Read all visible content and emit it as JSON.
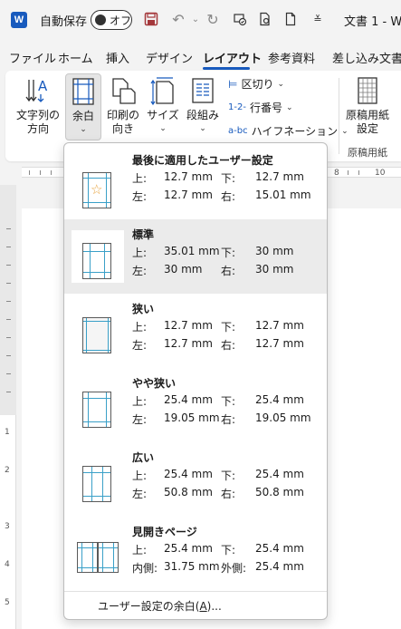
{
  "titlebar": {
    "app_icon": "W",
    "autosave_label": "自動保存",
    "autosave_state": "オフ",
    "doc_title": "文書 1 - W"
  },
  "tabs": [
    "ファイル",
    "ホーム",
    "挿入",
    "デザイン",
    "レイアウト",
    "参考資料",
    "差し込み文書"
  ],
  "active_tab": "レイアウト",
  "ribbon": {
    "text_direction": [
      "文字列の",
      "方向"
    ],
    "margins": [
      "余白"
    ],
    "orientation": [
      "印刷の",
      "向き"
    ],
    "size": [
      "サイズ"
    ],
    "columns": [
      "段組み"
    ],
    "breaks": "区切り",
    "line_numbers": "行番号",
    "hyphenation": "ハイフネーション",
    "manuscript": [
      "原稿用紙",
      "設定"
    ],
    "group_label": "原稿用紙"
  },
  "ruler": {
    "h_numbers": [
      "8",
      "10"
    ],
    "v_numbers": [
      "1",
      "2",
      "3",
      "4",
      "5"
    ]
  },
  "margins_menu": {
    "options": [
      {
        "name": "最後に適用したユーザー設定",
        "top_label": "上:",
        "top": "12.7 mm",
        "bottom_label": "下:",
        "bottom": "12.7 mm",
        "left_label": "左:",
        "left": "12.7 mm",
        "right_label": "右:",
        "right": "15.01 mm",
        "icon": "star-icon"
      },
      {
        "name": "標準",
        "top_label": "上:",
        "top": "35.01 mm",
        "bottom_label": "下:",
        "bottom": "30 mm",
        "left_label": "左:",
        "left": "30 mm",
        "right_label": "右:",
        "right": "30 mm",
        "highlighted": true
      },
      {
        "name": "狭い",
        "top_label": "上:",
        "top": "12.7 mm",
        "bottom_label": "下:",
        "bottom": "12.7 mm",
        "left_label": "左:",
        "left": "12.7 mm",
        "right_label": "右:",
        "right": "12.7 mm"
      },
      {
        "name": "やや狭い",
        "top_label": "上:",
        "top": "25.4 mm",
        "bottom_label": "下:",
        "bottom": "25.4 mm",
        "left_label": "左:",
        "left": "19.05 mm",
        "right_label": "右:",
        "right": "19.05 mm"
      },
      {
        "name": "広い",
        "top_label": "上:",
        "top": "25.4 mm",
        "bottom_label": "下:",
        "bottom": "25.4 mm",
        "left_label": "左:",
        "left": "50.8 mm",
        "right_label": "右:",
        "right": "50.8 mm"
      },
      {
        "name": "見開きページ",
        "top_label": "上:",
        "top": "25.4 mm",
        "bottom_label": "下:",
        "bottom": "25.4 mm",
        "left_label": "内側:",
        "left": "31.75 mm",
        "right_label": "外側:",
        "right": "25.4 mm"
      }
    ],
    "custom_label": "ユーザー設定の余白(",
    "custom_key": "A",
    "custom_suffix": ")..."
  },
  "colors": {
    "accent": "#185abd",
    "margin_line": "#3aa0c8",
    "highlight": "#ebebeb"
  }
}
